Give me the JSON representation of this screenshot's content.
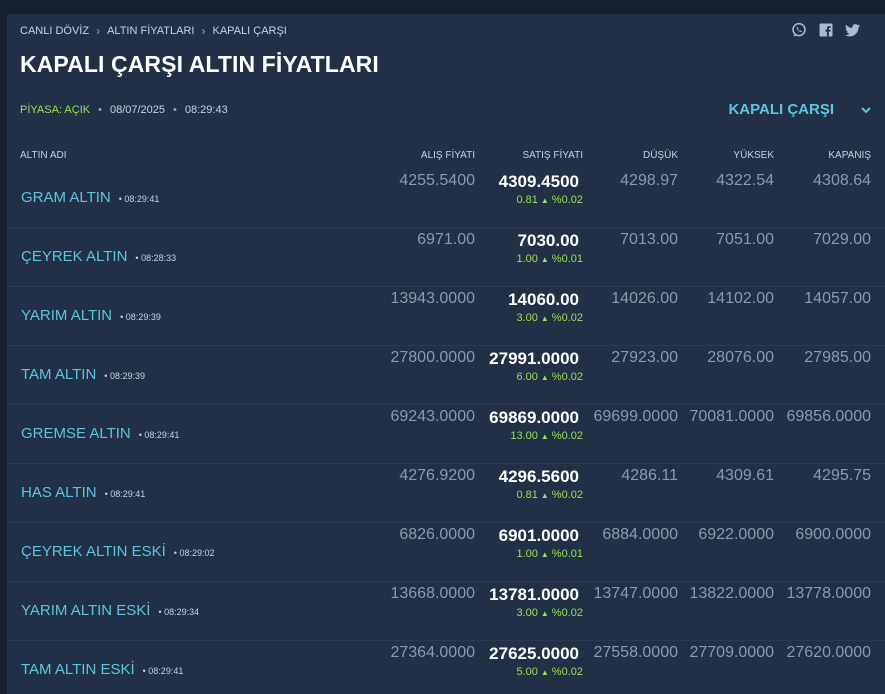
{
  "breadcrumb": [
    "CANLI DÖVİZ",
    "ALTIN FİYATLARI",
    "KAPALI ÇARŞI"
  ],
  "share_icons": [
    "whatsapp-icon",
    "facebook-icon",
    "twitter-icon"
  ],
  "title": "KAPALI ÇARŞI ALTIN FİYATLARI",
  "status": {
    "market": "PİYASA: AÇIK",
    "date": "08/07/2025",
    "time": "08:29:43"
  },
  "market_select": {
    "selected": "KAPALI ÇARŞI"
  },
  "columns": {
    "name": "ALTIN ADI",
    "buy": "ALIŞ FİYATI",
    "sell": "SATIŞ FİYATI",
    "low": "DÜŞÜK",
    "high": "YÜKSEK",
    "close": "KAPANIŞ"
  },
  "colors": {
    "accent": "#5ec5e0",
    "up": "#9be354",
    "panel": "#213046",
    "background": "#17202d"
  },
  "rows": [
    {
      "name": "GRAM ALTIN",
      "time": "08:29:41",
      "buy": "4255.5400",
      "sell": "4309.4500",
      "change": "0.81",
      "pct": "%0.02",
      "low": "4298.97",
      "high": "4322.54",
      "close": "4308.64"
    },
    {
      "name": "ÇEYREK ALTIN",
      "time": "08:28:33",
      "buy": "6971.00",
      "sell": "7030.00",
      "change": "1.00",
      "pct": "%0.01",
      "low": "7013.00",
      "high": "7051.00",
      "close": "7029.00"
    },
    {
      "name": "YARIM ALTIN",
      "time": "08:29:39",
      "buy": "13943.0000",
      "sell": "14060.00",
      "change": "3.00",
      "pct": "%0.02",
      "low": "14026.00",
      "high": "14102.00",
      "close": "14057.00"
    },
    {
      "name": "TAM ALTIN",
      "time": "08:29:39",
      "buy": "27800.0000",
      "sell": "27991.0000",
      "change": "6.00",
      "pct": "%0.02",
      "low": "27923.00",
      "high": "28076.00",
      "close": "27985.00"
    },
    {
      "name": "GREMSE ALTIN",
      "time": "08:29:41",
      "buy": "69243.0000",
      "sell": "69869.0000",
      "change": "13.00",
      "pct": "%0.02",
      "low": "69699.0000",
      "high": "70081.0000",
      "close": "69856.0000"
    },
    {
      "name": "HAS ALTIN",
      "time": "08:29:41",
      "buy": "4276.9200",
      "sell": "4296.5600",
      "change": "0.81",
      "pct": "%0.02",
      "low": "4286.11",
      "high": "4309.61",
      "close": "4295.75"
    },
    {
      "name": "ÇEYREK ALTIN ESKİ",
      "time": "08:29:02",
      "buy": "6826.0000",
      "sell": "6901.0000",
      "change": "1.00",
      "pct": "%0.01",
      "low": "6884.0000",
      "high": "6922.0000",
      "close": "6900.0000"
    },
    {
      "name": "YARIM ALTIN ESKİ",
      "time": "08:29:34",
      "buy": "13668.0000",
      "sell": "13781.0000",
      "change": "3.00",
      "pct": "%0.02",
      "low": "13747.0000",
      "high": "13822.0000",
      "close": "13778.0000"
    },
    {
      "name": "TAM ALTIN ESKİ",
      "time": "08:29:41",
      "buy": "27364.0000",
      "sell": "27625.0000",
      "change": "5.00",
      "pct": "%0.02",
      "low": "27558.0000",
      "high": "27709.0000",
      "close": "27620.0000"
    }
  ]
}
